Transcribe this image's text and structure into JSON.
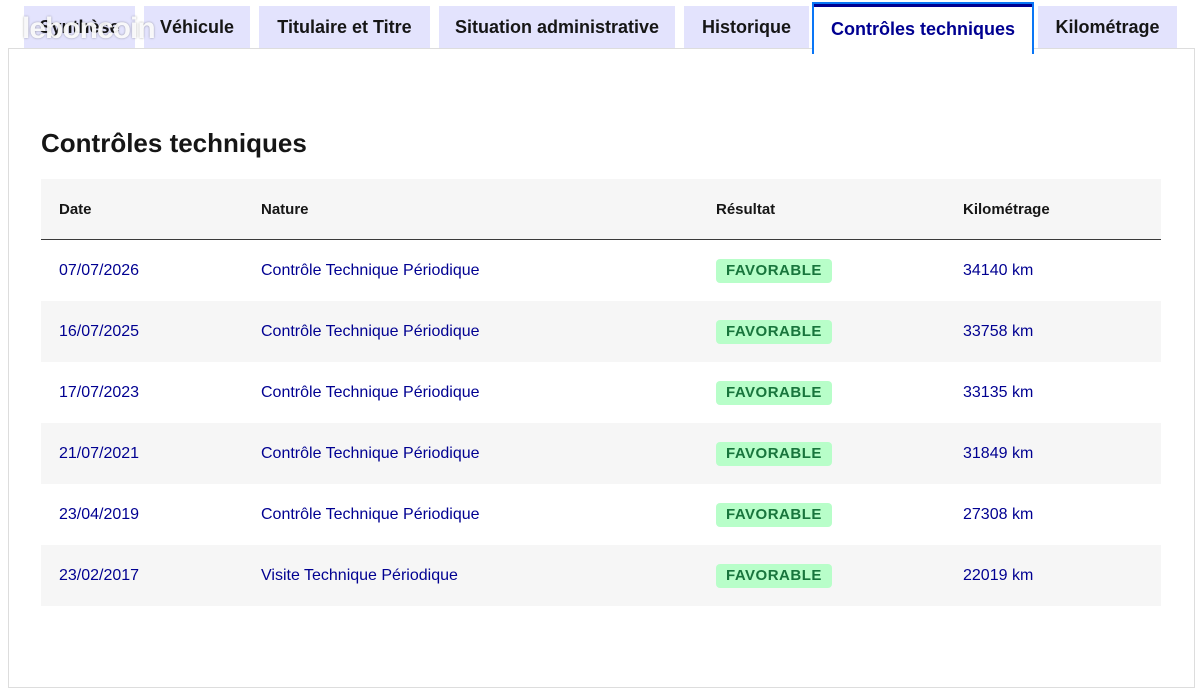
{
  "watermark": {
    "text": "leboncoin"
  },
  "tabs": [
    {
      "label": "Synthèse"
    },
    {
      "label": "Véhicule"
    },
    {
      "label": "Titulaire et Titre"
    },
    {
      "label": "Situation administrative"
    },
    {
      "label": "Historique"
    },
    {
      "label": "Contrôles techniques",
      "active": true
    },
    {
      "label": "Kilométrage"
    }
  ],
  "section": {
    "title": "Contrôles techniques"
  },
  "table": {
    "headers": {
      "date": "Date",
      "nature": "Nature",
      "result": "Résultat",
      "km": "Kilométrage"
    },
    "rows": [
      {
        "date": "07/07/2026",
        "nature": "Contrôle Technique Périodique",
        "result": "FAVORABLE",
        "km": "34140 km"
      },
      {
        "date": "16/07/2025",
        "nature": "Contrôle Technique Périodique",
        "result": "FAVORABLE",
        "km": "33758 km"
      },
      {
        "date": "17/07/2023",
        "nature": "Contrôle Technique Périodique",
        "result": "FAVORABLE",
        "km": "33135 km"
      },
      {
        "date": "21/07/2021",
        "nature": "Contrôle Technique Périodique",
        "result": "FAVORABLE",
        "km": "31849 km"
      },
      {
        "date": "23/04/2019",
        "nature": "Contrôle Technique Périodique",
        "result": "FAVORABLE",
        "km": "27308 km"
      },
      {
        "date": "23/02/2017",
        "nature": "Visite Technique Périodique",
        "result": "FAVORABLE",
        "km": "22019 km"
      }
    ]
  },
  "colors": {
    "tab_bg": "#e3e3fd",
    "active_text": "#000091",
    "active_border": "#0a76f6",
    "row_alt": "#f6f6f6",
    "badge_bg": "#b8fec9",
    "badge_text": "#18753c"
  }
}
